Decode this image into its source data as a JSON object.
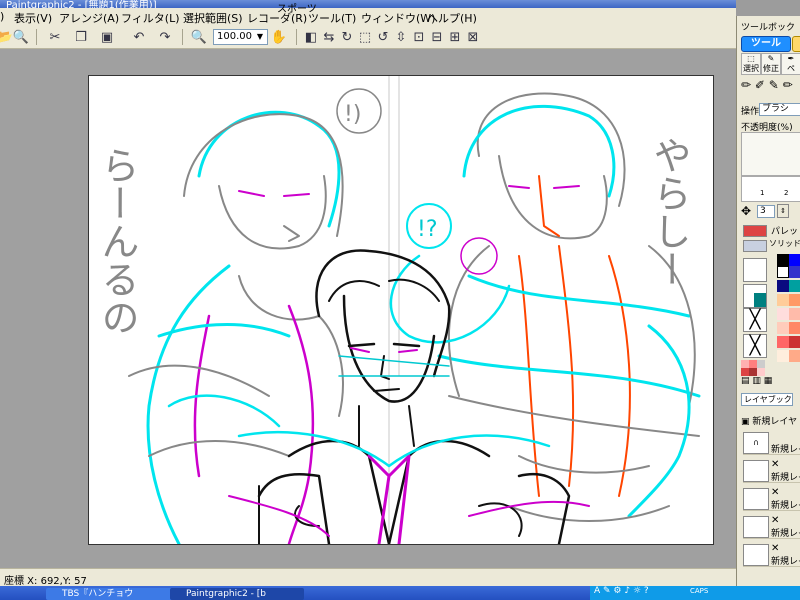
{
  "window": {
    "title": "Paintgraphic2 - [無題1(作業用)]"
  },
  "menu": [
    {
      "label": ")"
    },
    {
      "label": "表示(V)"
    },
    {
      "label": "アレンジ(A)"
    },
    {
      "label": "フィルタ(L)"
    },
    {
      "label": "選択範囲(S)"
    },
    {
      "label": "レコーダ(R)"
    },
    {
      "label": "ツール(T)"
    },
    {
      "label": "ウィンドウ(W)"
    },
    {
      "label": "ヘルプ(H)"
    }
  ],
  "floating_title": "スポーツ",
  "toolbar": {
    "zoom_value": "100.00"
  },
  "canvas": {
    "text_left": "らーんるの",
    "text_right": "やらしー",
    "bubble1": "!)",
    "bubble2": "!?"
  },
  "status": {
    "coords_text": "座標 X: 692,Y:  57"
  },
  "toolbox": {
    "title": "ツールボックス",
    "tab_tool": "ツール",
    "tool_select": "選択",
    "tool_correct": "修正",
    "tool_pen": "ペ",
    "operation_label": "操作",
    "operation_value": "ブラシ",
    "opacity_label": "不透明度(%)",
    "size_value": "3",
    "palette_label": "パレット",
    "solid_label": "ソリッドカ",
    "layer_mode": "レイヤブック",
    "new_layer_label": "新規レイヤ",
    "layers": [
      {
        "name": "新規レイ"
      },
      {
        "name": "新規レイ"
      },
      {
        "name": "新規レイ"
      },
      {
        "name": "新規レイ"
      },
      {
        "name": "新規レイ"
      }
    ],
    "palette_colors": [
      "#000000",
      "#0000ff",
      "#ffffff",
      "#3333cc",
      "#ffcc99",
      "#ff9966",
      "#ffdddd",
      "#ffbbaa",
      "#ffccbb",
      "#ff8866",
      "#ff6666",
      "#cc3333"
    ]
  },
  "taskbar": {
    "items": [
      {
        "label": "TBS『ハンチョウ"
      },
      {
        "label": "Paintgraphic2 - [b"
      }
    ],
    "tray_text": "CAPS"
  }
}
